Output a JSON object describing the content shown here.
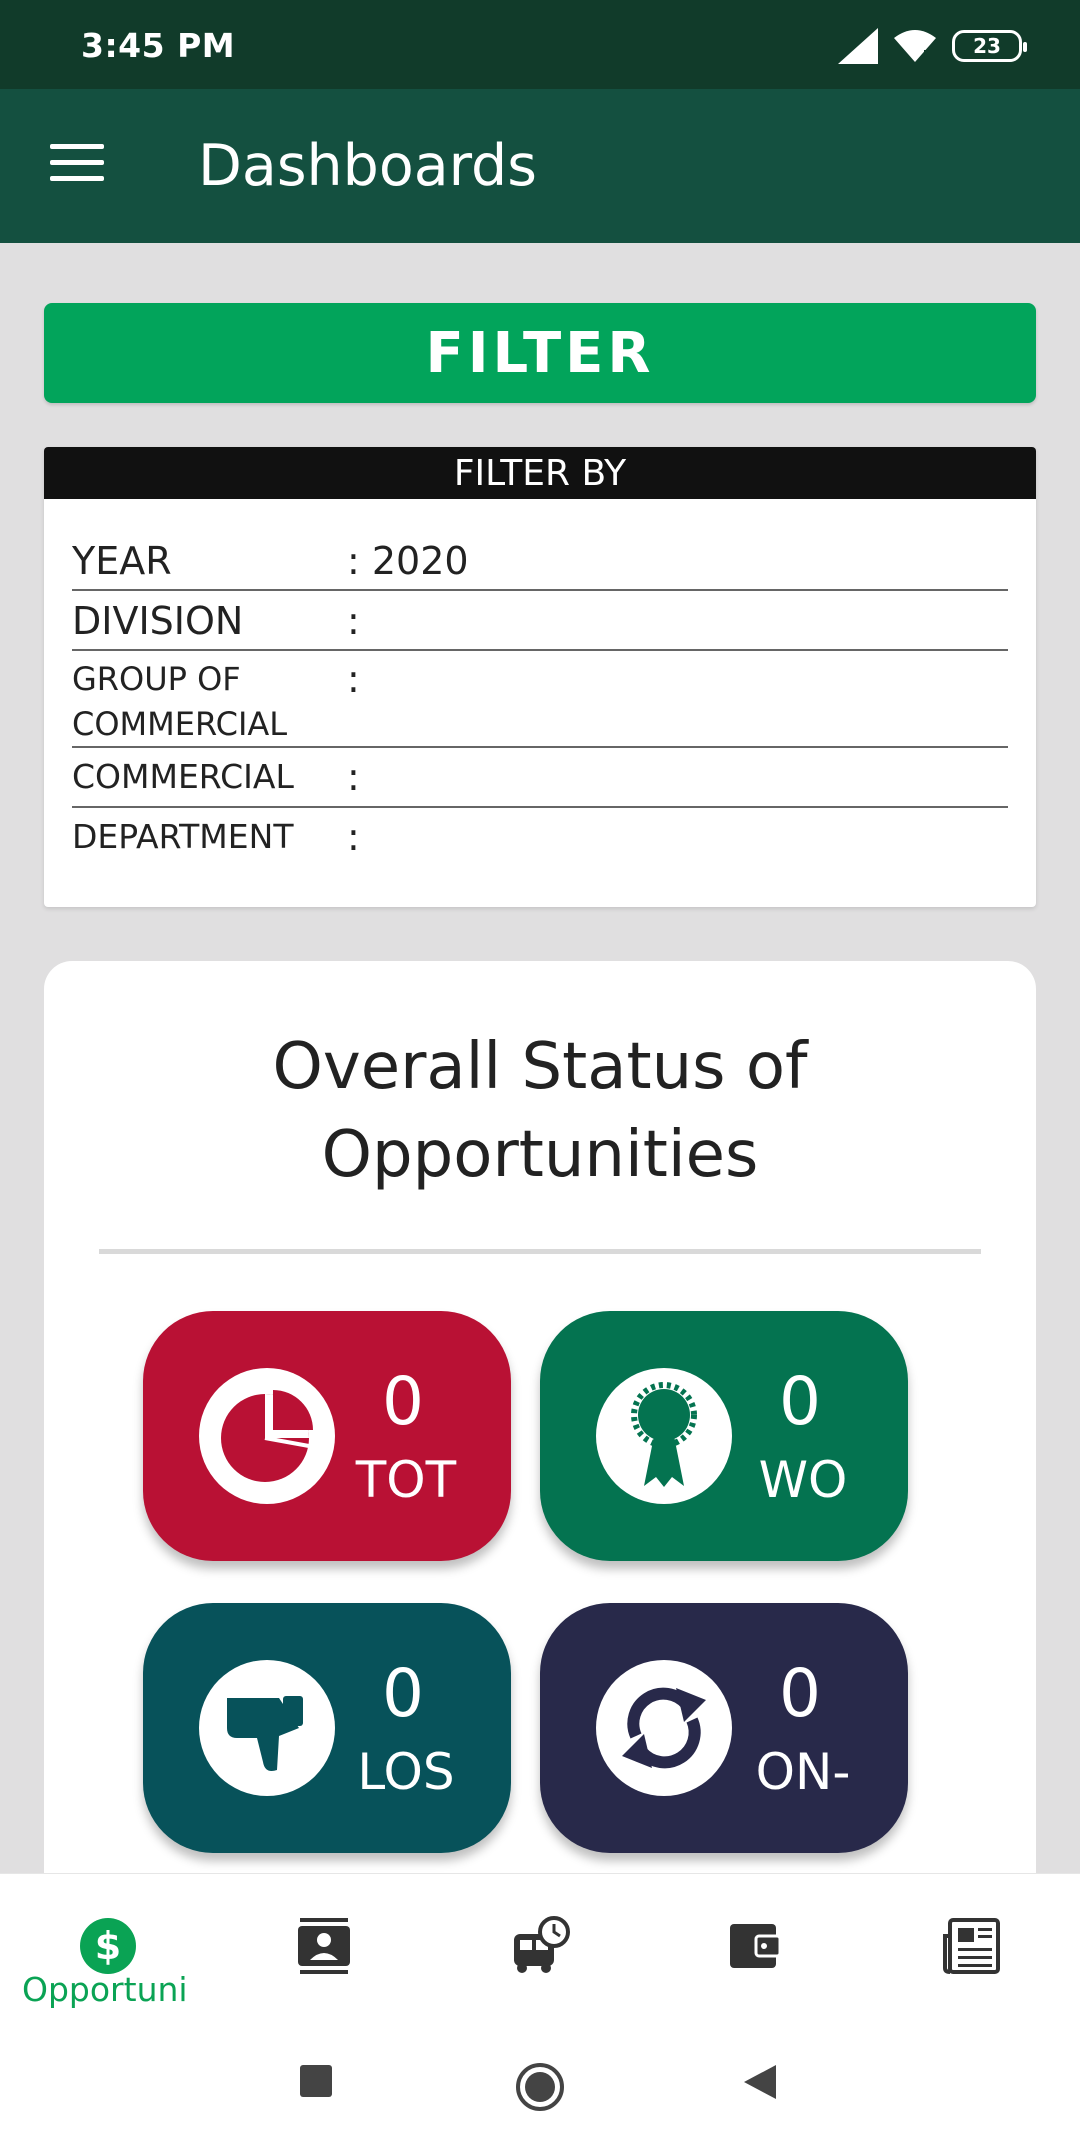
{
  "status_bar": {
    "time": "3:45 PM",
    "battery": "23"
  },
  "app_bar": {
    "title": "Dashboards"
  },
  "filter_button": {
    "label": "FILTER"
  },
  "filter_card": {
    "header": "FILTER BY",
    "rows": [
      {
        "key": "YEAR",
        "value": ": 2020"
      },
      {
        "key": "DIVISION",
        "value": ":"
      },
      {
        "key": "GROUP OF COMMERCIAL",
        "value": ":"
      },
      {
        "key": "COMMERCIAL",
        "value": ":"
      },
      {
        "key": "DEPARTMENT",
        "value": ":"
      }
    ]
  },
  "status_card": {
    "title": "Overall Status of Opportunities",
    "tiles": [
      {
        "count": "0",
        "label": "TOT",
        "icon": "pie-chart-icon",
        "color": "#b91134"
      },
      {
        "count": "0",
        "label": "WO",
        "icon": "award-ribbon-icon",
        "color": "#047350"
      },
      {
        "count": "0",
        "label": "LOS",
        "icon": "thumbs-down-icon",
        "color": "#07525a"
      },
      {
        "count": "0",
        "label": "ON-",
        "icon": "sync-icon",
        "color": "#28294a"
      }
    ]
  },
  "bottom_nav": {
    "items": [
      {
        "label": "Opportuni",
        "icon": "dollar-circle-icon",
        "active": true
      },
      {
        "icon": "contact-card-icon"
      },
      {
        "icon": "bus-clock-icon"
      },
      {
        "icon": "wallet-icon"
      },
      {
        "icon": "newspaper-icon"
      }
    ]
  },
  "colors": {
    "status_bar": "#113b2a",
    "app_bar": "#145040",
    "filter_button": "#02a45b",
    "active_nav": "#0aa354"
  }
}
